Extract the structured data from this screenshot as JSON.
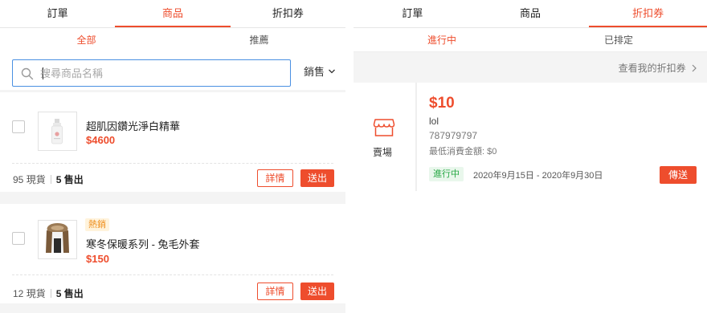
{
  "left_panel": {
    "tabs": [
      {
        "label": "訂單",
        "active": false
      },
      {
        "label": "商品",
        "active": true
      },
      {
        "label": "折扣券",
        "active": false
      }
    ],
    "subtabs": [
      {
        "label": "全部",
        "active": true
      },
      {
        "label": "推薦",
        "active": false
      }
    ],
    "search": {
      "placeholder": "搜尋商品名稱",
      "value": ""
    },
    "sort": {
      "label": "銷售"
    },
    "products": [
      {
        "name": "超肌因鑽光淨白精華",
        "price": "$4600",
        "badge": "",
        "stock_count": "95",
        "stock_label": "現貨",
        "sold_count": "5",
        "sold_label": "售出",
        "detail_label": "詳情",
        "send_label": "送出",
        "thumb_icon": "serum-bottle-icon"
      },
      {
        "name": "寒冬保暖系列 - 兔毛外套",
        "price": "$150",
        "badge": "熱銷",
        "stock_count": "12",
        "stock_label": "現貨",
        "sold_count": "5",
        "sold_label": "售出",
        "detail_label": "詳情",
        "send_label": "送出",
        "thumb_icon": "fur-coat-icon"
      }
    ]
  },
  "right_panel": {
    "tabs": [
      {
        "label": "訂單",
        "active": false
      },
      {
        "label": "商品",
        "active": false
      },
      {
        "label": "折扣券",
        "active": true
      }
    ],
    "subtabs": [
      {
        "label": "進行中",
        "active": true
      },
      {
        "label": "已排定",
        "active": false
      }
    ],
    "my_coupons_link": "查看我的折扣券",
    "coupon": {
      "store_label": "賣場",
      "store_icon": "store-icon",
      "value": "$10",
      "name": "lol",
      "code": "787979797",
      "min_spend": "最低消費金額: $0",
      "status": "進行中",
      "period": "2020年9月15日 - 2020年9月30日",
      "send_label": "傳送"
    }
  },
  "colors": {
    "accent": "#ee4d2d",
    "focus_border": "#4a90e2",
    "status_green": "#27a844",
    "hot_badge": "#ee8e1c",
    "background": "#f4f4f4"
  }
}
